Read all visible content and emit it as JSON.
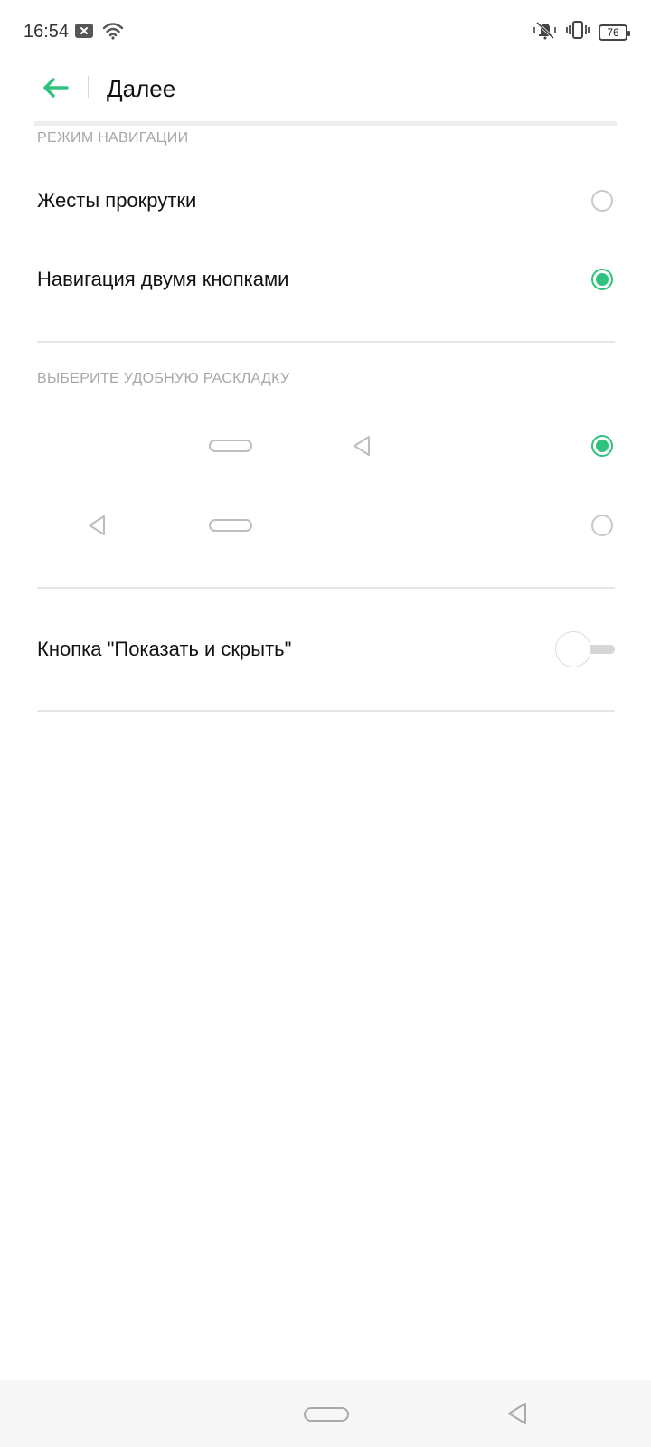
{
  "status_bar": {
    "time": "16:54",
    "battery": "76",
    "icons": [
      "notification-close-icon",
      "wifi-icon",
      "silent-mode-icon",
      "vibrate-icon",
      "battery-icon"
    ]
  },
  "header": {
    "title": "Далее",
    "back_icon": "arrow-left-icon"
  },
  "navigation_mode": {
    "section_label": "РЕЖИМ НАВИГАЦИИ",
    "options": [
      {
        "label": "Жесты прокрутки",
        "selected": false
      },
      {
        "label": "Навигация двумя кнопками",
        "selected": true
      }
    ]
  },
  "layout": {
    "section_label": "ВЫБЕРИТЕ УДОБНУЮ РАСКЛАДКУ",
    "options": [
      {
        "buttons": [
          "home-pill-icon",
          "back-triangle-icon"
        ],
        "selected": true
      },
      {
        "buttons": [
          "back-triangle-icon",
          "home-pill-icon"
        ],
        "selected": false
      }
    ]
  },
  "show_hide": {
    "label": "Кнопка \"Показать и скрыть\"",
    "enabled": false
  },
  "nav_bar": {
    "icons": [
      "home-pill-icon",
      "back-triangle-icon"
    ]
  },
  "colors": {
    "accent": "#2ec27e",
    "text_primary": "#111111",
    "text_secondary": "#a7a7a7",
    "divider": "#e6e6e6"
  }
}
